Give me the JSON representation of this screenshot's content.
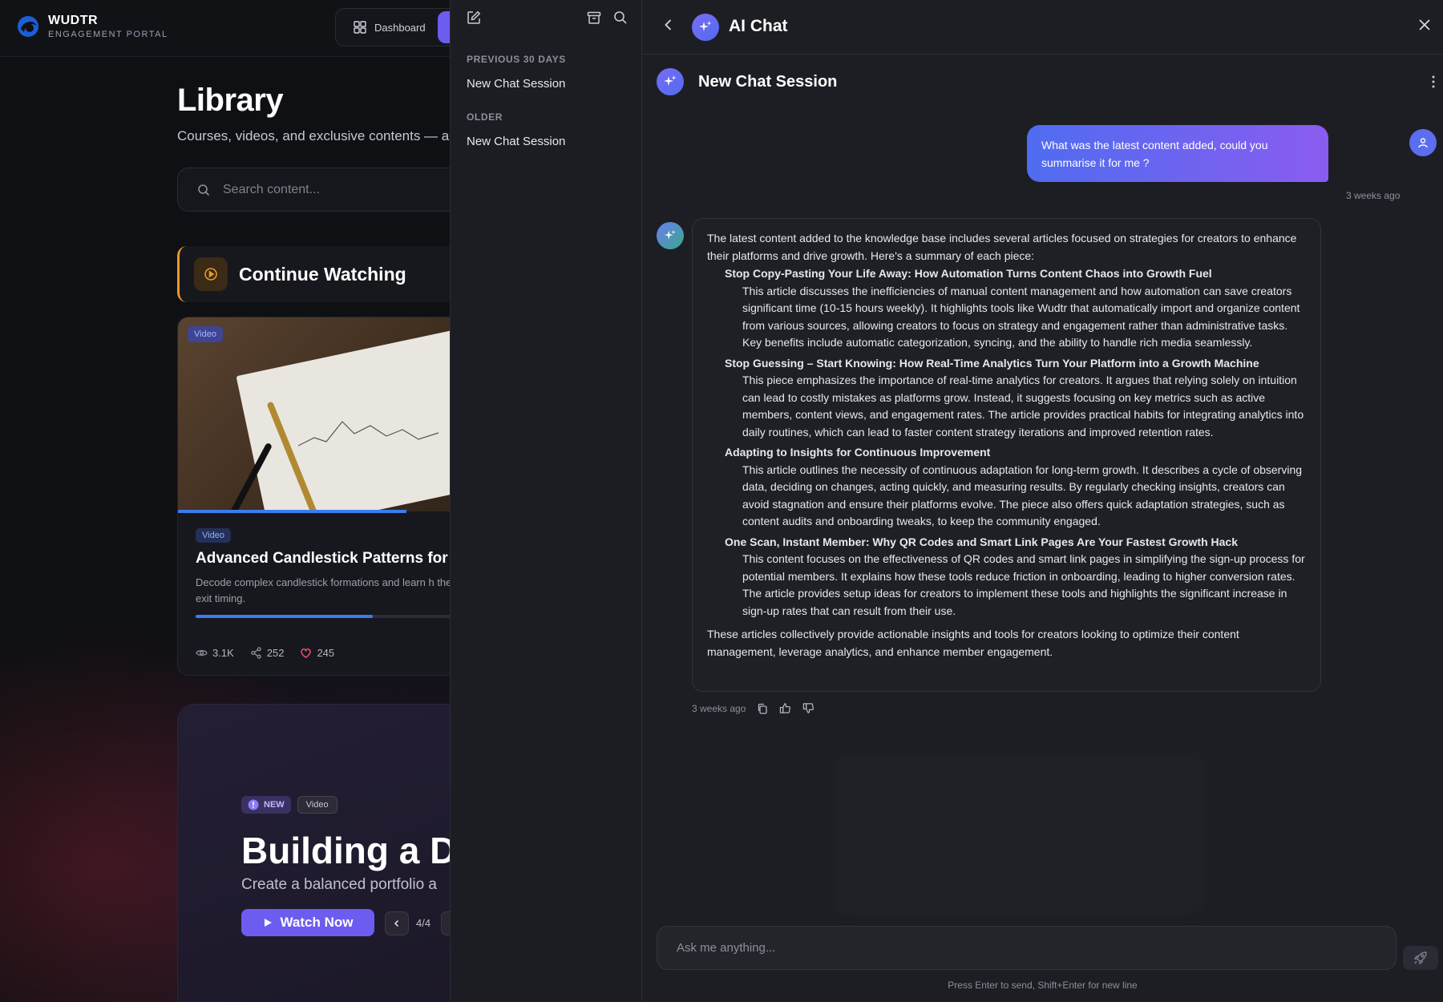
{
  "brand": {
    "name": "WUDTR",
    "tagline": "ENGAGEMENT PORTAL"
  },
  "nav": {
    "dashboard_label": "Dashboard"
  },
  "library": {
    "title": "Library",
    "subtitle": "Courses, videos, and exclusive contents — al",
    "search_placeholder": "Search content..."
  },
  "continue_watching": {
    "title": "Continue Watching",
    "card": {
      "image_badge": "Video",
      "badge": "Video",
      "title": "Advanced Candlestick Patterns for",
      "description": "Decode complex candlestick formations and learn h them for precise entry and exit timing.",
      "progress": 0.47,
      "views": "3.1K",
      "shares": "252",
      "likes": "245"
    }
  },
  "featured": {
    "badge_new": "NEW",
    "badge_type": "Video",
    "title": "Building a Di",
    "subtitle": "Create a balanced portfolio a",
    "watch_label": "Watch Now",
    "pager": "4/4"
  },
  "history": {
    "groups": [
      {
        "label": "PREVIOUS 30 DAYS",
        "items": [
          "New Chat Session"
        ]
      },
      {
        "label": "OLDER",
        "items": [
          "New Chat Session"
        ]
      }
    ]
  },
  "chat": {
    "title": "AI Chat",
    "session_title": "New Chat Session",
    "user_message": "What was the latest content added, could you summarise it for me ?",
    "user_time": "3 weeks ago",
    "ai_intro": "The latest content added to the knowledge base includes several articles focused on strategies for creators to enhance their platforms and drive growth. Here's a summary of each piece:",
    "ai_items": [
      {
        "title": "Stop Copy-Pasting Your Life Away: How Automation Turns Content Chaos into Growth Fuel",
        "body": "This article discusses the inefficiencies of manual content management and how automation can save creators significant time (10-15 hours weekly). It highlights tools like Wudtr that automatically import and organize content from various sources, allowing creators to focus on strategy and engagement rather than administrative tasks. Key benefits include automatic categorization, syncing, and the ability to handle rich media seamlessly."
      },
      {
        "title": "Stop Guessing – Start Knowing: How Real-Time Analytics Turn Your Platform into a Growth Machine",
        "body": "This piece emphasizes the importance of real-time analytics for creators. It argues that relying solely on intuition can lead to costly mistakes as platforms grow. Instead, it suggests focusing on key metrics such as active members, content views, and engagement rates. The article provides practical habits for integrating analytics into daily routines, which can lead to faster content strategy iterations and improved retention rates."
      },
      {
        "title": "Adapting to Insights for Continuous Improvement",
        "body": "This article outlines the necessity of continuous adaptation for long-term growth. It describes a cycle of observing data, deciding on changes, acting quickly, and measuring results. By regularly checking insights, creators can avoid stagnation and ensure their platforms evolve. The piece also offers quick adaptation strategies, such as content audits and onboarding tweaks, to keep the community engaged."
      },
      {
        "title": "One Scan, Instant Member: Why QR Codes and Smart Link Pages Are Your Fastest Growth Hack",
        "body": "This content focuses on the effectiveness of QR codes and smart link pages in simplifying the sign-up process for potential members. It explains how these tools reduce friction in onboarding, leading to higher conversion rates. The article provides setup ideas for creators to implement these tools and highlights the significant increase in sign-up rates that can result from their use."
      }
    ],
    "ai_outro": "These articles collectively provide actionable insights and tools for creators looking to optimize their content management, leverage analytics, and enhance member engagement.",
    "ai_time": "3 weeks ago",
    "input_placeholder": "Ask me anything...",
    "hint": "Press Enter to send, Shift+Enter for new line"
  }
}
